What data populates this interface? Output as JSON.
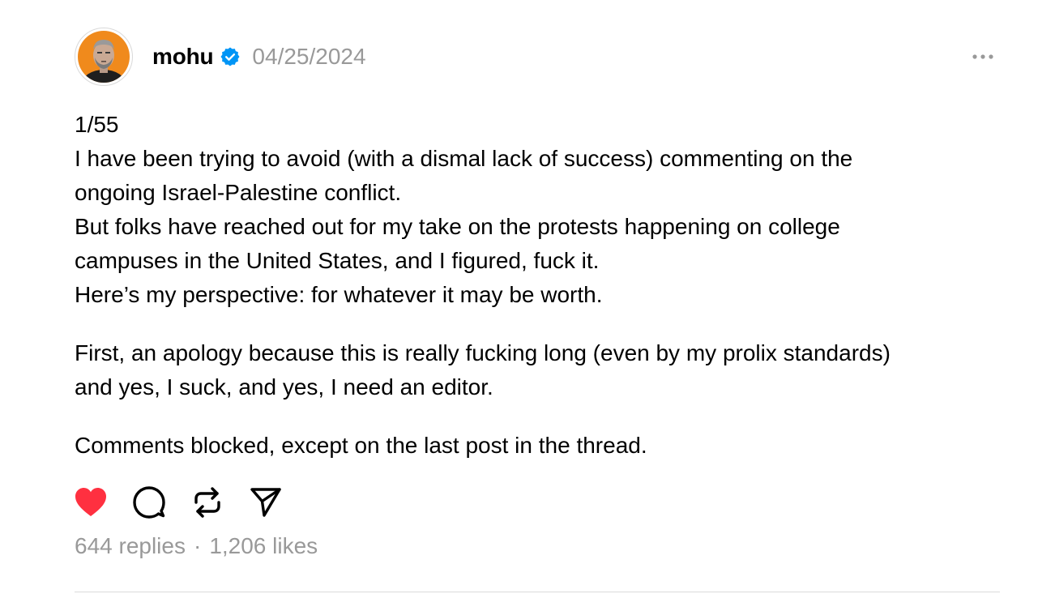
{
  "post": {
    "author": {
      "username": "mohu",
      "verified": true,
      "avatar_icon": "profile-photo-avatar"
    },
    "date": "04/25/2024",
    "more_icon": "more-horizontal-icon",
    "body": {
      "paragraphs": [
        [
          "1/55",
          "I have been trying to avoid (with a dismal lack of success) commenting on the",
          "ongoing Israel-Palestine conflict.",
          "But folks have reached out for my take on the protests happening on college",
          "campuses in the United States, and I figured, fuck it.",
          "Here’s my perspective: for whatever it may be worth."
        ],
        [
          "First, an apology because this is really fucking long (even by my prolix standards)",
          "and yes, I suck, and yes, I need an editor."
        ],
        [
          "Comments blocked, except on the last post in the thread."
        ]
      ]
    },
    "actions": {
      "like_icon": "heart-filled-icon",
      "like_color": "#ff3040",
      "reply_icon": "comment-bubble-icon",
      "repost_icon": "repost-icon",
      "share_icon": "send-icon"
    },
    "stats": {
      "replies": "644 replies",
      "separator": "·",
      "likes": "1,206 likes"
    },
    "colors": {
      "text": "#000000",
      "muted": "#999999",
      "verified": "#0095f6",
      "avatar_bg": "#f08a1c"
    }
  }
}
